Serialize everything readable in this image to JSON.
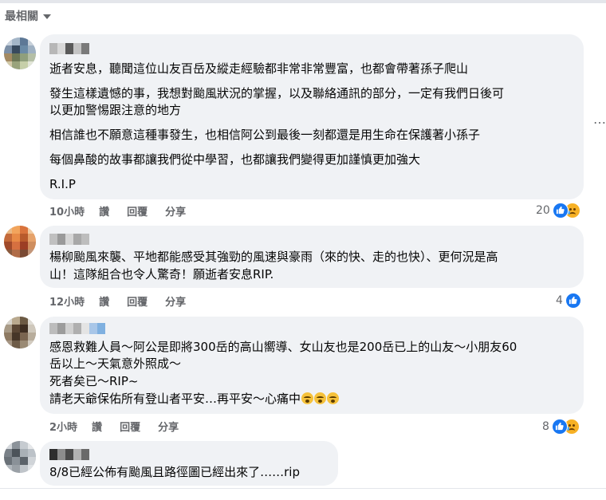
{
  "sort": {
    "label": "最相關"
  },
  "comments": [
    {
      "paragraphs": [
        "逝者安息，聽聞這位山友百岳及縱走經驗都非常非常豐富，也都會帶著孫子爬山",
        "發生這樣遺憾的事，我想對颱風狀況的掌握，以及聯絡通訊的部分，一定有我們日後可",
        "以更加警惕跟注意的地方",
        "相信誰也不願意這種事發生，也相信阿公到最後一刻都還是用生命在保護著小孫子",
        "每個鼻酸的故事都讓我們從中學習，也都讓我們變得更加謹慎更加強大",
        "R.I.P"
      ],
      "time": "10小時",
      "actions": [
        "讚",
        "回覆",
        "分享"
      ],
      "reactions_count": "20",
      "reactions": [
        "like-icon",
        "sad-icon"
      ]
    },
    {
      "paragraphs": [
        "楊柳颱風來襲、平地都能感受其強勁的風速與豪雨（來的快、走的也快）、更何況是高",
        "山！這隊組合也令人驚奇！願逝者安息RIP."
      ],
      "time": "12小時",
      "actions": [
        "讚",
        "回覆",
        "分享"
      ],
      "reactions_count": "4",
      "reactions": [
        "like-icon"
      ]
    },
    {
      "paragraphs": [
        "感恩救難人員～阿公是即將300岳的高山嚮導、女山友也是200岳已上的山友～小朋友60",
        "岳以上～天氣意外照成～",
        "死者矣已～RIP~",
        "請老天爺保佑所有登山者平安…再平安～心痛中"
      ],
      "emoji_after_last": [
        "crying-face-icon",
        "crying-face-icon",
        "crying-face-icon"
      ],
      "time": "2小時",
      "actions": [
        "讚",
        "回覆",
        "分享"
      ],
      "reactions_count": "8",
      "reactions": [
        "like-icon",
        "sad-icon"
      ]
    },
    {
      "paragraphs": [
        "8/8已經公佈有颱風且路徑圖已經出來了……rip"
      ]
    }
  ],
  "more_menu": "…",
  "colors": {
    "bubble": "#f0f2f5",
    "meta_text": "#65676b",
    "like_blue": "#1877f2",
    "sad_yellow": "#f7b125"
  }
}
